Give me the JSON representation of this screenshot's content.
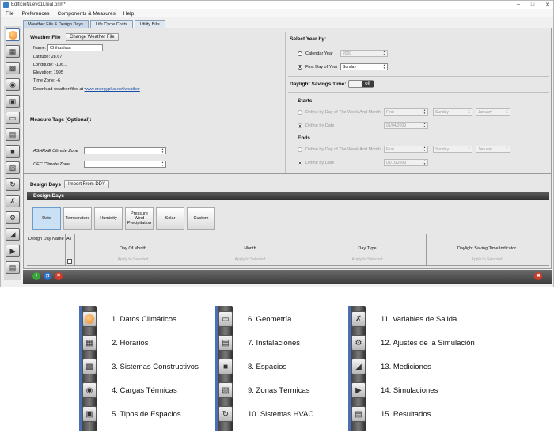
{
  "window": {
    "title": "EdificioNuevo1Lreal.osm*",
    "min": "–",
    "max": "□",
    "close": "✕"
  },
  "menu": [
    "File",
    "Preferences",
    "Components & Measures",
    "Help"
  ],
  "tabs": [
    "Weather File & Design Days",
    "Life Cycle Costs",
    "Utility Bills"
  ],
  "weather": {
    "heading": "Weather File",
    "change_button": "Change Weather File",
    "name_label": "Name:",
    "name_value": "Chihuahua",
    "latitude": "Latitude: 28.67",
    "longitude": "Longitude: -106.1",
    "elevation": "Elevation: 1995",
    "timezone": "Time Zone: -6",
    "download_prefix": "Download weather files at ",
    "download_link": "www.energyplus.net/weather"
  },
  "measure_tags": {
    "heading": "Measure Tags (Optional):",
    "ashrae_label": "ASHRAE Climate Zone",
    "cec_label": "CEC Climate Zone",
    "ashrae_value": "",
    "cec_value": ""
  },
  "year": {
    "heading": "Select Year by:",
    "calendar_label": "Calendar Year",
    "calendar_value": "2000",
    "first_day_label": "First Day of Year",
    "first_day_value": "Sunday"
  },
  "dst": {
    "heading": "Daylight Savings Time:",
    "toggle": "off",
    "starts": "Starts",
    "ends": "Ends",
    "define_dow": "Define by Day of The Week And Month",
    "define_date": "Define by Date",
    "start_week": "First",
    "start_day": "Sunday",
    "start_month": "January",
    "start_date": "01/04/2009",
    "end_week": "First",
    "end_day": "Sunday",
    "end_month": "January",
    "end_date": "01/10/2009"
  },
  "design_days": {
    "label": "Design Days",
    "import_button": "Import From DDY",
    "bar_title": "Design Days",
    "buttons": [
      "Date",
      "Temperature",
      "Humidity",
      "Pressure\nWind\nPrecipitation",
      "Solar",
      "Custom"
    ],
    "col_name": "Design Day Name",
    "col_all": "All",
    "columns": [
      "Day Of Month",
      "Month",
      "Day Type",
      "Daylight Saving Time Indicator"
    ],
    "apply": "Apply to Selected"
  },
  "bottom": {
    "add": "+",
    "copy": "❐",
    "remove": "×",
    "purge": "✖"
  },
  "sidebar_icons": [
    "site-icon",
    "schedules-icon",
    "constructions-icon",
    "loads-icon",
    "space-types-icon",
    "geometry-icon",
    "facility-icon",
    "spaces-icon",
    "thermal-zones-icon",
    "hvac-icon",
    "output-variables-icon",
    "simulation-settings-icon",
    "measures-icon",
    "run-icon",
    "results-icon"
  ],
  "legend": [
    "1. Datos Climáticos",
    "2. Horarios",
    "3. Sistemas Constructivos",
    "4. Cargas Térmicas",
    "5. Tipos de Espacios",
    "6. Geometría",
    "7. Instalaciones",
    "8. Espacios",
    "9. Zonas Térmicas",
    "10. Sistemas HVAC",
    "11. Variables de Salida",
    "12. Ajustes de la Simulación",
    "13. Mediciones",
    "14. Simulaciones",
    "15. Resultados"
  ],
  "colors": {
    "accent": "#4a6fb5",
    "orange": "#e8892a",
    "darkbar": "#3a3a3a"
  }
}
